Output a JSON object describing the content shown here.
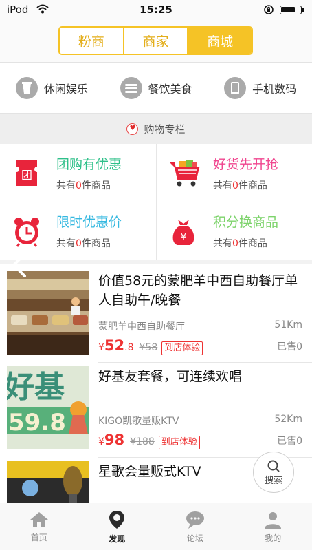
{
  "status_bar": {
    "carrier": "iPod",
    "time": "15:25"
  },
  "segments": [
    {
      "label": "粉商",
      "active": false
    },
    {
      "label": "商家",
      "active": false
    },
    {
      "label": "商城",
      "active": true
    }
  ],
  "categories": [
    {
      "label": "休闲娱乐",
      "icon": "cup-icon"
    },
    {
      "label": "餐饮美食",
      "icon": "plate-icon"
    },
    {
      "label": "手机数码",
      "icon": "phone-icon"
    }
  ],
  "shopping_section": {
    "title": "购物专栏"
  },
  "promos": [
    {
      "title": "团购有优惠",
      "sub_prefix": "共有",
      "count": "0",
      "sub_suffix": "件商品",
      "color": "#2fc08a",
      "icon": "ticket-icon"
    },
    {
      "title": "好货先开抢",
      "sub_prefix": "共有",
      "count": "0",
      "sub_suffix": "件商品",
      "color": "#f0468f",
      "icon": "cart-icon"
    },
    {
      "title": "限时优惠价",
      "sub_prefix": "共有",
      "count": "0",
      "sub_suffix": "件商品",
      "color": "#35b8e0",
      "icon": "alarm-clock-icon"
    },
    {
      "title": "积分换商品",
      "sub_prefix": "共有",
      "count": "0",
      "sub_suffix": "件商品",
      "color": "#7dd36b",
      "icon": "money-bag-icon"
    }
  ],
  "listings": [
    {
      "title": "价值58元的蒙肥羊中西自助餐厅单人自助午/晚餐",
      "shop": "蒙肥羊中西自助餐厅",
      "distance": "51Km",
      "price_symbol": "¥",
      "price_int": "52",
      "price_dec": ".8",
      "old_price": "¥58",
      "tag": "到店体验",
      "sold": "已售0"
    },
    {
      "title": "好基友套餐，可连续欢唱",
      "shop": "KIGO凯歌量贩KTV",
      "distance": "52Km",
      "price_symbol": "¥",
      "price_int": "98",
      "price_dec": "",
      "old_price": "¥188",
      "tag": "到店体验",
      "sold": "已售0"
    },
    {
      "title": "星歌会量贩式KTV"
    }
  ],
  "search_fab": {
    "label": "搜索"
  },
  "tabbar": [
    {
      "label": "首页",
      "active": false,
      "icon": "home-icon"
    },
    {
      "label": "发现",
      "active": true,
      "icon": "location-pin-icon"
    },
    {
      "label": "论坛",
      "active": false,
      "icon": "chat-bubble-icon"
    },
    {
      "label": "我的",
      "active": false,
      "icon": "person-icon"
    }
  ],
  "colors": {
    "accent": "#f5c326",
    "price": "#e33333"
  }
}
